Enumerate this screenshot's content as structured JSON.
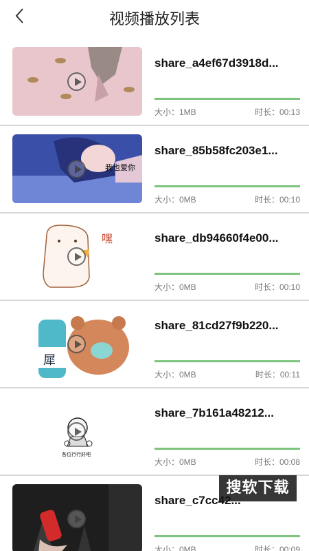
{
  "header": {
    "title": "视频播放列表",
    "back_icon": "chevron-left-icon"
  },
  "videos": [
    {
      "name": "share_a4ef67d3918d...",
      "size": "大小：1MB",
      "duration": "时长：00:13",
      "progress": 1.0
    },
    {
      "name": "share_85b58fc203e1...",
      "size": "大小：0MB",
      "duration": "时长：00:10",
      "progress": 1.0,
      "thumb_caption": "我也爱你"
    },
    {
      "name": "share_db94660f4e00...",
      "size": "大小：0MB",
      "duration": "时长：00:10",
      "progress": 1.0,
      "thumb_caption": "嘿"
    },
    {
      "name": "share_81cd27f9b220...",
      "size": "大小：0MB",
      "duration": "时长：00:11",
      "progress": 1.0,
      "thumb_caption": "犀"
    },
    {
      "name": "share_7b161a48212...",
      "size": "大小：0MB",
      "duration": "时长：00:08",
      "progress": 1.0,
      "thumb_caption": "各位行行好吧"
    },
    {
      "name": "share_c7cc42...",
      "size": "大小：0MB",
      "duration": "时长：00:09",
      "progress": 1.0
    }
  ],
  "watermark": "搜软下载",
  "colors": {
    "progress": "#7cc47e",
    "divider": "#d8d8d8"
  }
}
